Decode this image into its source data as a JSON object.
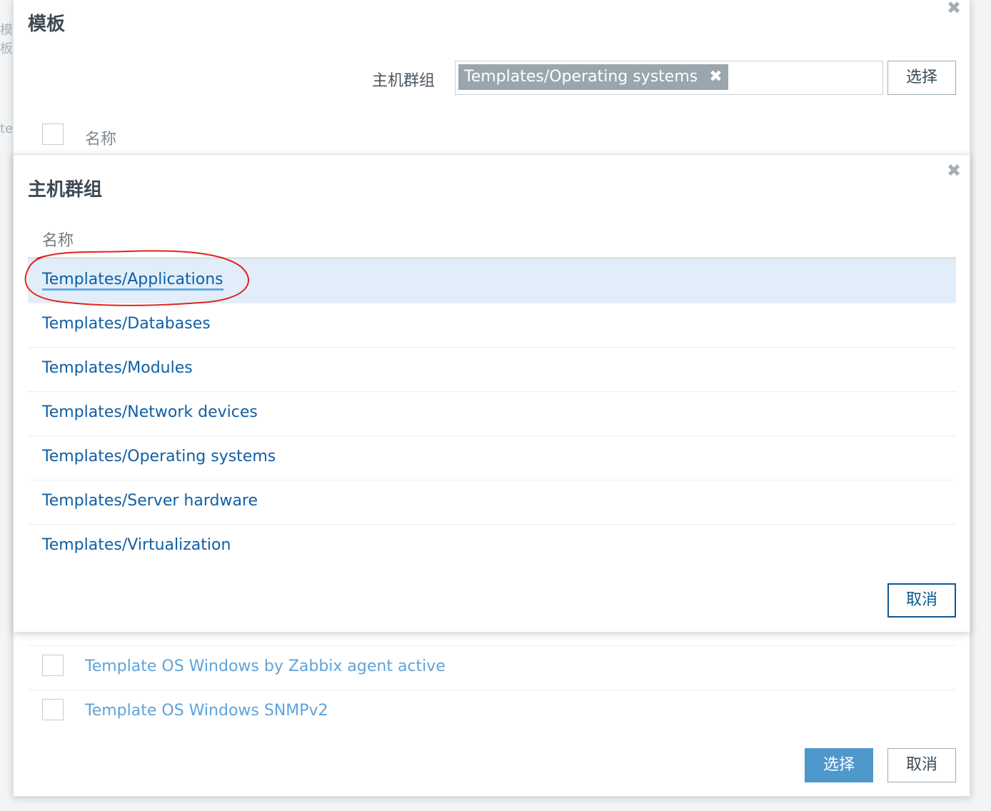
{
  "background": {
    "left_fragments": [
      "模板",
      "te"
    ]
  },
  "outer_dialog": {
    "title": "模板",
    "close_icon": "close-icon",
    "host_group_label": "主机群组",
    "selected_tag": "Templates/Operating systems",
    "tag_remove_icon": "remove-icon",
    "select_button": "选择",
    "name_column": "名称",
    "visible_templates": [
      "Template OS Windows by Zabbix agent active",
      "Template OS Windows SNMPv2"
    ],
    "footer_select_button": "选择",
    "footer_cancel_button": "取消"
  },
  "inner_dialog": {
    "title": "主机群组",
    "close_icon": "close-icon",
    "name_column": "名称",
    "groups": [
      "Templates/Applications",
      "Templates/Databases",
      "Templates/Modules",
      "Templates/Network devices",
      "Templates/Operating systems",
      "Templates/Server hardware",
      "Templates/Virtualization"
    ],
    "highlighted_index": 0,
    "cancel_button": "取消"
  },
  "colors": {
    "link": "#0f5fa4",
    "highlight_row": "#e1eef9",
    "annotation": "#e0241b",
    "primary_button": "#4f98cc"
  }
}
